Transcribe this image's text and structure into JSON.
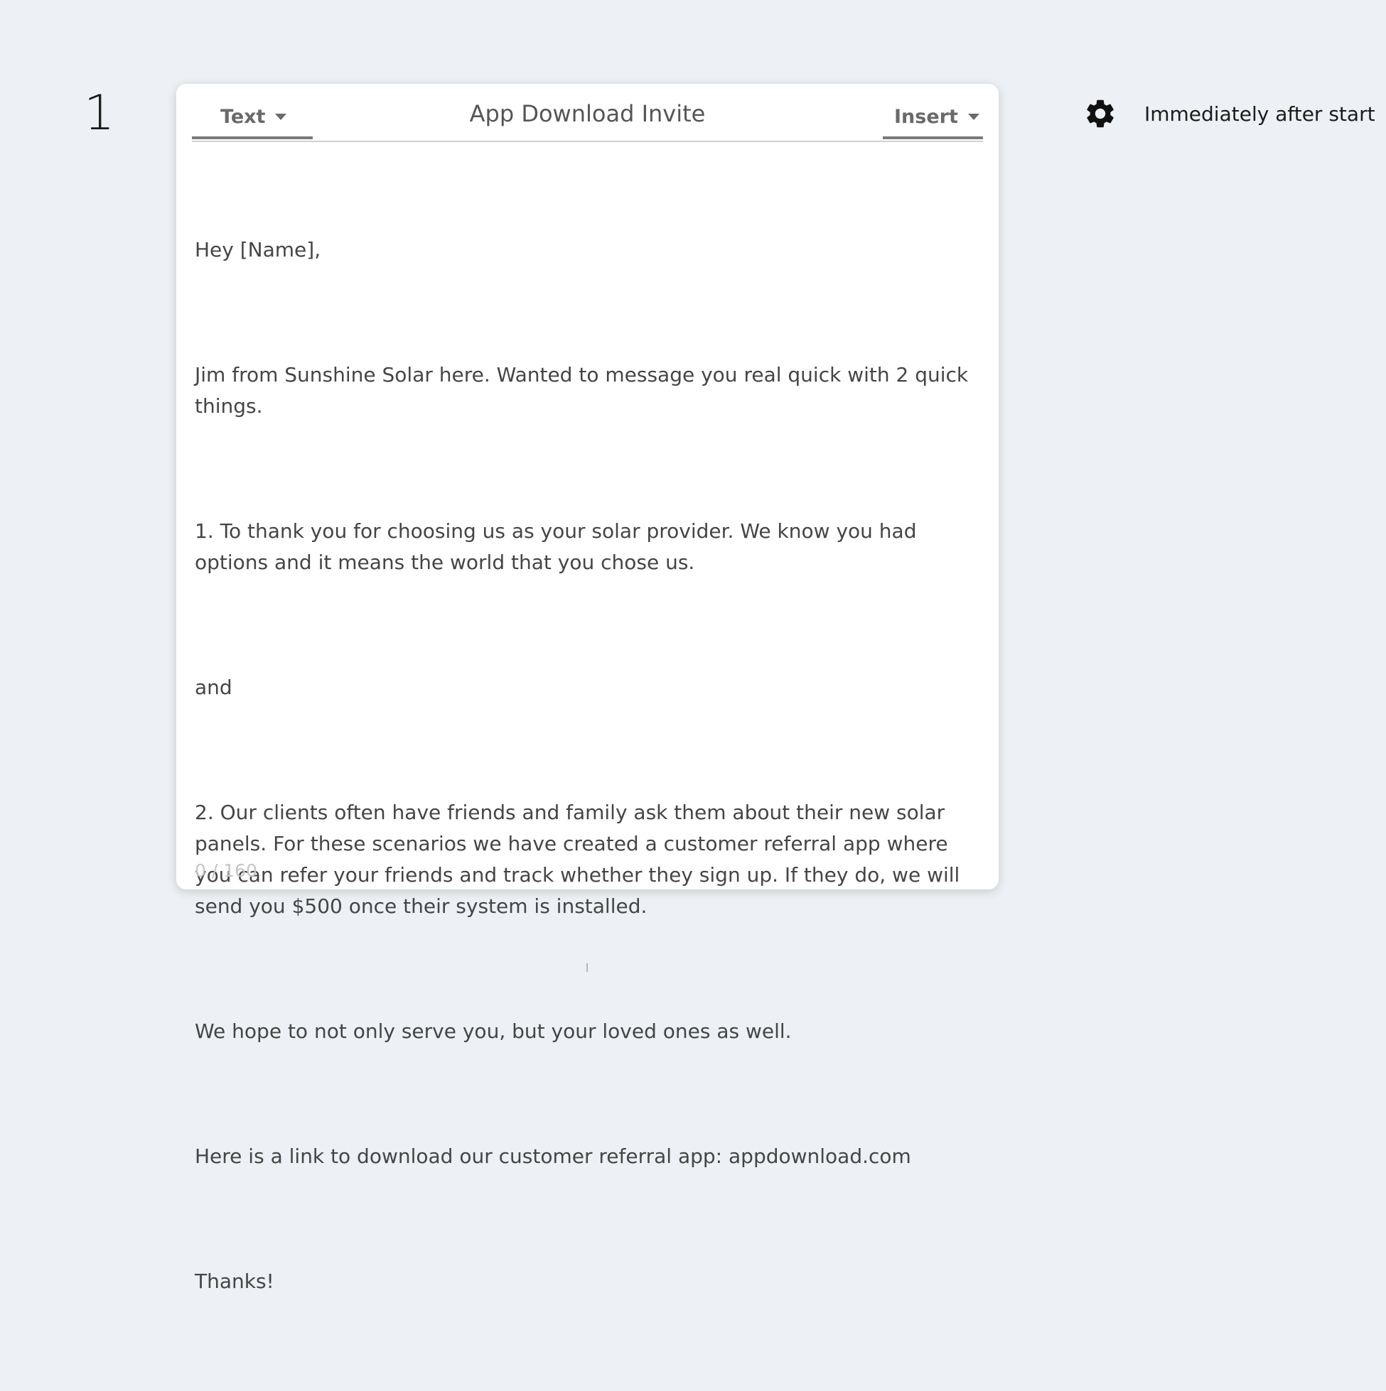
{
  "step": {
    "number": "1"
  },
  "card": {
    "type_dropdown": {
      "label": "Text"
    },
    "title": "App Download Invite",
    "insert_dropdown": {
      "label": "Insert"
    },
    "message_paragraphs": [
      "Hey [Name],",
      "Jim from Sunshine Solar here. Wanted to message you real quick with 2 quick things.",
      "1. To thank you for choosing us as your solar provider. We know you had options and it means the world that you chose us.",
      "and",
      "2. Our clients often have friends and family ask them about their new solar panels. For these scenarios we have created a customer referral app where you can refer your friends and track whether they sign up. If they do, we will send you $500 once their system is installed.",
      "We hope to not only serve you, but your loved ones as well.",
      "Here is a link to download our customer referral app: appdownload.com",
      "Thanks!"
    ],
    "char_counter": "0 / 160"
  },
  "settings": {
    "icon": "gear-icon",
    "timing_label": "Immediately after start"
  }
}
